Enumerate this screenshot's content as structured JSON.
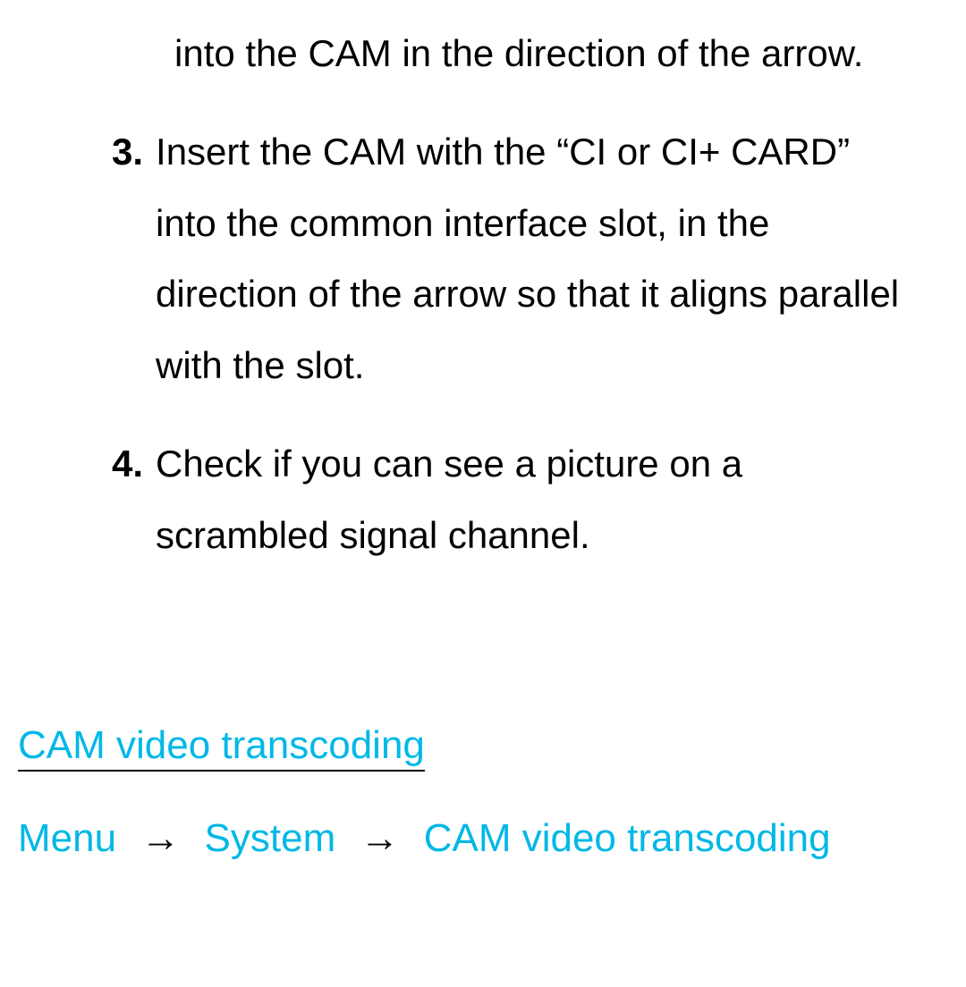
{
  "list": {
    "continuation": "into the CAM in the direction of the arrow.",
    "item3": {
      "number": "3.",
      "text": "Insert the CAM with the “CI or CI+ CARD” into the common interface slot, in the direction of the arrow so that it aligns parallel with the slot."
    },
    "item4": {
      "number": "4.",
      "text": "Check if you can see a picture on a scrambled signal channel."
    }
  },
  "heading": "CAM video transcoding",
  "breadcrumb": {
    "item1": "Menu",
    "sep1": "→",
    "item2": "System",
    "sep2": "→",
    "item3": "CAM video transcoding"
  }
}
